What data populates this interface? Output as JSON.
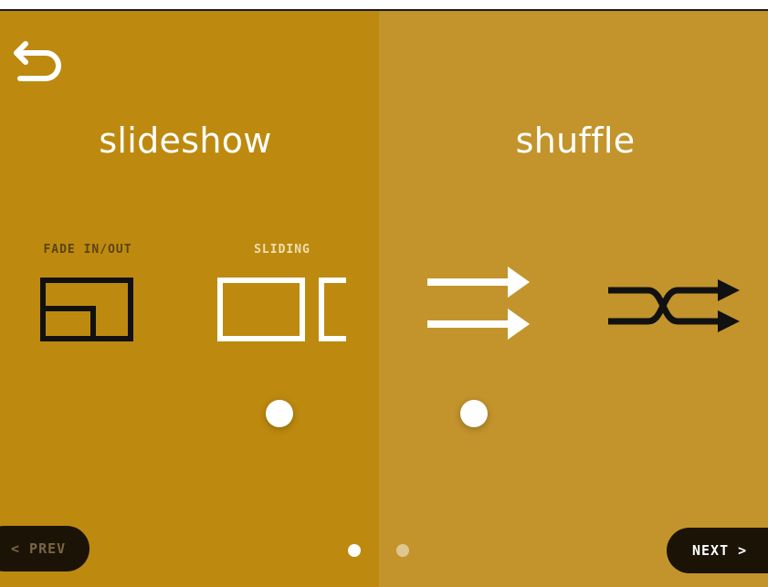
{
  "slideshow": {
    "title": "slideshow",
    "options": [
      {
        "label": "FADE IN/OUT",
        "icon": "fade-in-out-icon",
        "color": "#111111"
      },
      {
        "label": "SLIDING",
        "icon": "sliding-icon",
        "color": "#ffffff",
        "selected": true
      }
    ]
  },
  "shuffle": {
    "title": "shuffle",
    "options": [
      {
        "icon": "straight-arrows-icon",
        "color": "#ffffff",
        "selected": true
      },
      {
        "icon": "shuffle-icon",
        "color": "#111111"
      }
    ]
  },
  "nav": {
    "back_icon": "back-arrow-icon",
    "prev_label": "< PREV",
    "next_label": "NEXT >",
    "page_count": 2,
    "current_page": 1
  },
  "colors": {
    "left_panel": "#bd8a0f",
    "right_panel": "#c3942c",
    "button_bg": "#1c1307"
  }
}
